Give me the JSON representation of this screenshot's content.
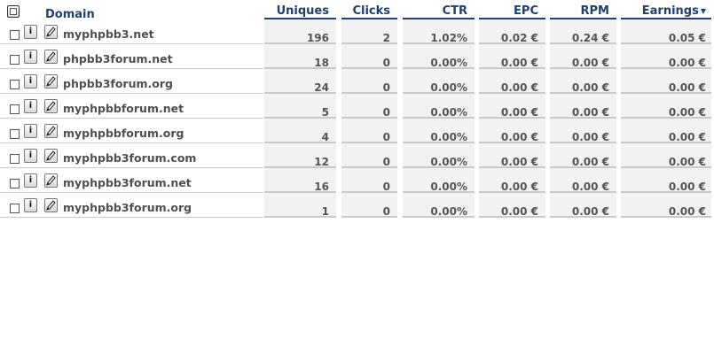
{
  "header": {
    "domain_label": "Domain",
    "uniques_label": "Uniques",
    "clicks_label": "Clicks",
    "ctr_label": "CTR",
    "epc_label": "EPC",
    "rpm_label": "RPM",
    "earnings_label": "Earnings",
    "sort_indicator": "▼"
  },
  "icons": {
    "info": "info-icon",
    "edit": "pencil-icon"
  },
  "rows": [
    {
      "domain": "myphpbb3.net",
      "uniques": "196",
      "clicks": "2",
      "ctr": "1.02%",
      "epc": "0.02 €",
      "rpm": "0.24 €",
      "earnings": "0.05 €"
    },
    {
      "domain": "phpbb3forum.net",
      "uniques": "18",
      "clicks": "0",
      "ctr": "0.00%",
      "epc": "0.00 €",
      "rpm": "0.00 €",
      "earnings": "0.00 €"
    },
    {
      "domain": "phpbb3forum.org",
      "uniques": "24",
      "clicks": "0",
      "ctr": "0.00%",
      "epc": "0.00 €",
      "rpm": "0.00 €",
      "earnings": "0.00 €"
    },
    {
      "domain": "myphpbbforum.net",
      "uniques": "5",
      "clicks": "0",
      "ctr": "0.00%",
      "epc": "0.00 €",
      "rpm": "0.00 €",
      "earnings": "0.00 €"
    },
    {
      "domain": "myphpbbforum.org",
      "uniques": "4",
      "clicks": "0",
      "ctr": "0.00%",
      "epc": "0.00 €",
      "rpm": "0.00 €",
      "earnings": "0.00 €"
    },
    {
      "domain": "myphpbb3forum.com",
      "uniques": "12",
      "clicks": "0",
      "ctr": "0.00%",
      "epc": "0.00 €",
      "rpm": "0.00 €",
      "earnings": "0.00 €"
    },
    {
      "domain": "myphpbb3forum.net",
      "uniques": "16",
      "clicks": "0",
      "ctr": "0.00%",
      "epc": "0.00 €",
      "rpm": "0.00 €",
      "earnings": "0.00 €"
    },
    {
      "domain": "myphpbb3forum.org",
      "uniques": "1",
      "clicks": "0",
      "ctr": "0.00%",
      "epc": "0.00 €",
      "rpm": "0.00 €",
      "earnings": "0.00 €"
    }
  ]
}
